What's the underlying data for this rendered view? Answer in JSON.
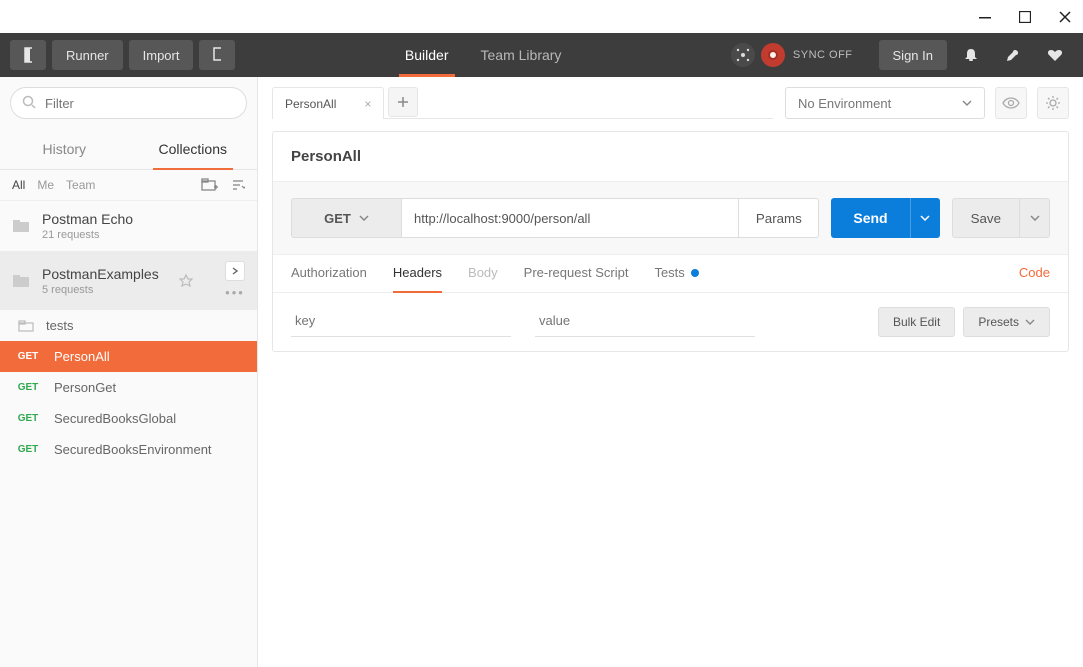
{
  "window": {
    "top_tabs": {
      "builder": "Builder",
      "team_library": "Team Library"
    },
    "runner_label": "Runner",
    "import_label": "Import",
    "sign_in_label": "Sign In",
    "sync_label": "SYNC OFF"
  },
  "sidebar": {
    "filter_placeholder": "Filter",
    "tabs": {
      "history": "History",
      "collections": "Collections"
    },
    "filters": {
      "all": "All",
      "me": "Me",
      "team": "Team"
    },
    "collections": [
      {
        "name": "Postman Echo",
        "sub": "21 requests"
      },
      {
        "name": "PostmanExamples",
        "sub": "5 requests"
      }
    ],
    "subfolders": [
      {
        "name": "tests"
      }
    ],
    "requests": [
      {
        "method": "GET",
        "name": "PersonAll",
        "active": true
      },
      {
        "method": "GET",
        "name": "PersonGet"
      },
      {
        "method": "GET",
        "name": "SecuredBooksGlobal"
      },
      {
        "method": "GET",
        "name": "SecuredBooksEnvironment"
      }
    ]
  },
  "content": {
    "tab_name": "PersonAll",
    "env_label": "No Environment",
    "request_name": "PersonAll",
    "method": "GET",
    "url": "http://localhost:9000/person/all",
    "params_label": "Params",
    "send_label": "Send",
    "save_label": "Save",
    "sub_tabs": {
      "authorization": "Authorization",
      "headers": "Headers",
      "body": "Body",
      "prerequest": "Pre-request Script",
      "tests": "Tests"
    },
    "code_link": "Code",
    "kv": {
      "key_placeholder": "key",
      "value_placeholder": "value"
    },
    "bulk_edit_label": "Bulk Edit",
    "presets_label": "Presets"
  }
}
